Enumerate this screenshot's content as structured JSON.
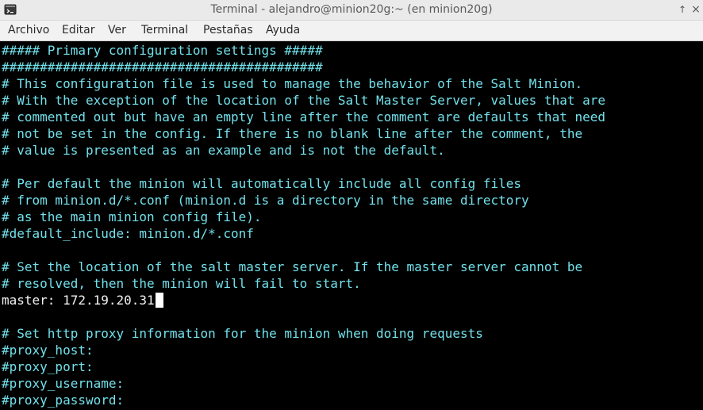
{
  "window": {
    "title": "Terminal - alejandro@minion20g:~ (en minion20g)",
    "icon": "terminal-icon",
    "maximize_glyph": "↑",
    "close_glyph": "×"
  },
  "menubar": {
    "items": [
      "Archivo",
      "Editar",
      "Ver",
      "Terminal",
      "Pestañas",
      "Ayuda"
    ]
  },
  "terminal": {
    "colors": {
      "background": "#000000",
      "comment": "#72e0ea",
      "plain": "#f2f2f2",
      "cursor": "#ffffff"
    },
    "lines": [
      "##### Primary configuration settings #####",
      "##########################################",
      "# This configuration file is used to manage the behavior of the Salt Minion.",
      "# With the exception of the location of the Salt Master Server, values that are",
      "# commented out but have an empty line after the comment are defaults that need",
      "# not be set in the config. If there is no blank line after the comment, the",
      "# value is presented as an example and is not the default.",
      "",
      "# Per default the minion will automatically include all config files",
      "# from minion.d/*.conf (minion.d is a directory in the same directory",
      "# as the main minion config file).",
      "#default_include: minion.d/*.conf",
      "",
      "# Set the location of the salt master server. If the master server cannot be",
      "# resolved, then the minion will fail to start.",
      "master: 172.19.20.31",
      "",
      "# Set http proxy information for the minion when doing requests",
      "#proxy_host:",
      "#proxy_port:",
      "#proxy_username:",
      "#proxy_password:"
    ],
    "cursor_line_index": 15
  }
}
